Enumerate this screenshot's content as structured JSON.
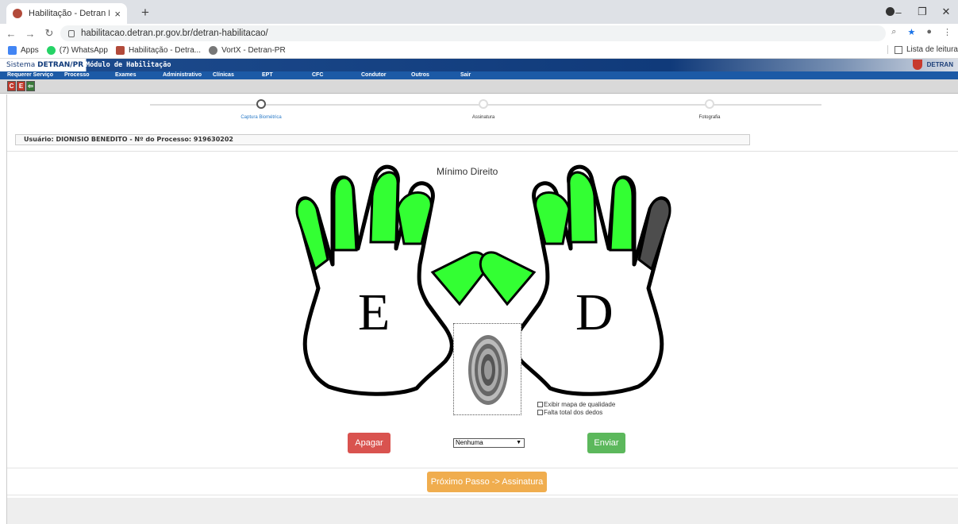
{
  "browser": {
    "tab_title": "Habilitação - Detran PR",
    "tab_close": "×",
    "new_tab": "+",
    "url": "habilitacao.detran.pr.gov.br/detran-habilitacao/",
    "bookmarks": [
      "Apps",
      "(7) WhatsApp",
      "Habilitação - Detra...",
      "VortX - Detran-PR"
    ],
    "reading_list": "Lista de leitura"
  },
  "header": {
    "system_prefix": "Sistema ",
    "system_name": "DETRAN/PR",
    "module": "Módulo de Habilitação",
    "brand": "DETRAN"
  },
  "menu": [
    "Requerer Serviço",
    "Processo",
    "Exames",
    "Administrativo",
    "Clínicas",
    "EPT",
    "CFC",
    "Condutor",
    "Outros",
    "Sair"
  ],
  "wizard": {
    "steps": [
      "Captura Biométrica",
      "Assinatura",
      "Fotografia"
    ],
    "active": 0
  },
  "user_bar": "Usuário: DIONISIO BENEDITO - Nº do Processo: 919630202",
  "capture": {
    "finger_title": "Mínimo Direito",
    "left_letter": "E",
    "right_letter": "D",
    "check_quality": "Exibir mapa de qualidade",
    "check_missing": "Falta total dos dedos",
    "delete_label": "Apagar",
    "send_label": "Enviar",
    "select_value": "Nenhuma",
    "next_label": "Próximo Passo -> Assinatura"
  },
  "colors": {
    "finger_ok": "#33ff33",
    "finger_selected": "#4d4d4d",
    "delete": "#d9534f",
    "send": "#5cb85c",
    "next": "#f0ad4e"
  }
}
